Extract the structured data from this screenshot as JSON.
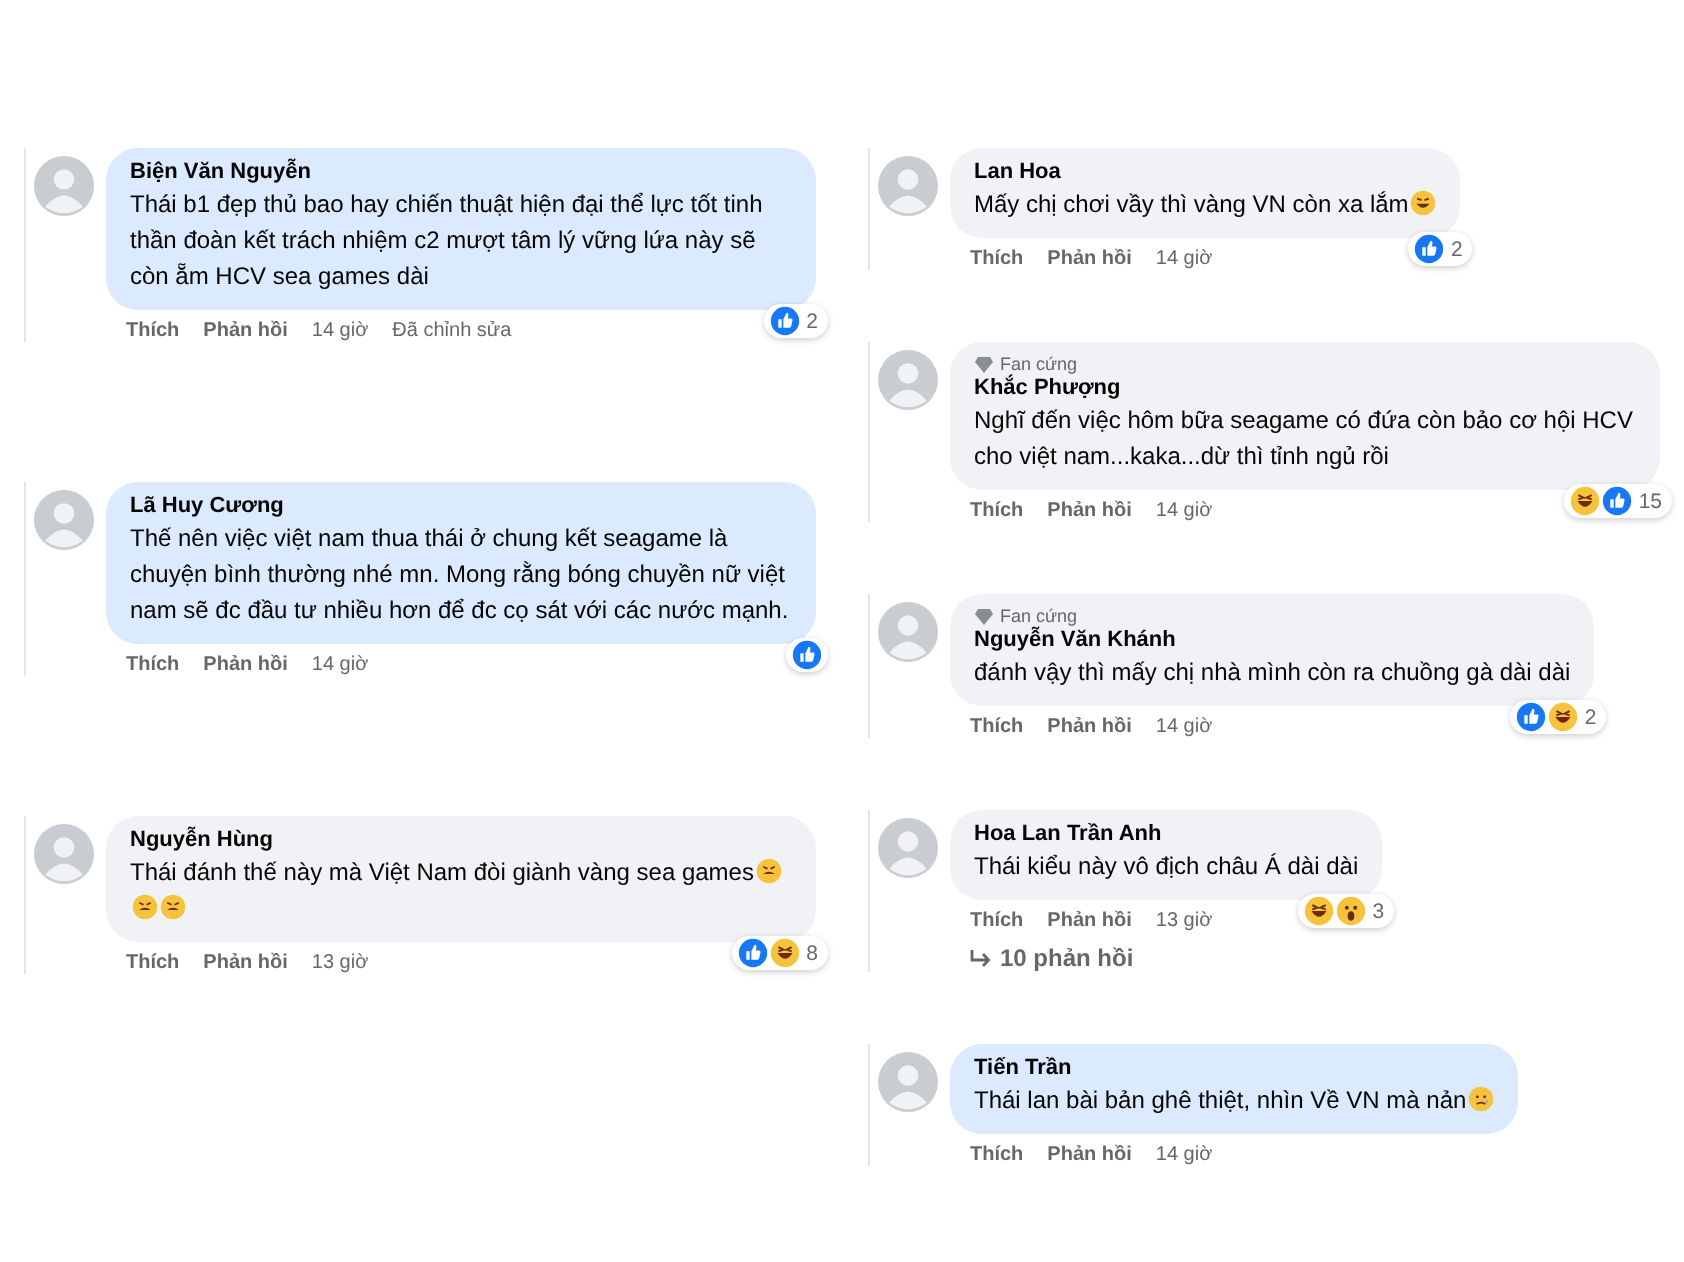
{
  "columns": [
    {
      "comments": [
        {
          "name": "Biện Văn Nguyễn",
          "text": "Thái b1 đẹp thủ bao hay chiến thuật hiện đại thể lực tốt tinh thần đoàn kết trách nhiệm c2 mượt tâm lý vững lứa này sẽ còn ẵm HCV sea games dài",
          "highlighted": true,
          "actions": [
            "Thích",
            "Phản hồi"
          ],
          "time": "14 giờ",
          "edited": "Đã chỉnh sửa",
          "reactions": [
            {
              "kind": "like"
            }
          ],
          "reaction_count": "2"
        },
        {
          "name": "Lã Huy Cương",
          "text": "Thế nên việc việt nam thua thái ở chung kết seagame là chuyện bình thường nhé mn. Mong rằng bóng chuyền nữ việt nam sẽ đc đầu tư nhiều hơn để đc cọ sát với các nước mạnh.",
          "highlighted": true,
          "actions": [
            "Thích",
            "Phản hồi"
          ],
          "time": "14 giờ",
          "reactions": [
            {
              "kind": "like"
            }
          ]
        },
        {
          "name": "Nguyễn Hùng",
          "text": "Thái đánh thế này mà Việt Nam đòi giành vàng sea games",
          "highlighted": false,
          "emojis": [
            {
              "kind": "tired"
            },
            {
              "kind": "tired"
            },
            {
              "kind": "tired"
            }
          ],
          "actions": [
            "Thích",
            "Phản hồi"
          ],
          "time": "13 giờ",
          "reactions": [
            {
              "kind": "like"
            },
            {
              "kind": "haha"
            }
          ],
          "reaction_count": "8"
        }
      ]
    },
    {
      "comments": [
        {
          "name": "Lan Hoa",
          "text": "Mấy chị chơi vầy thì vàng VN còn xa lắm",
          "highlighted": false,
          "emojis": [
            {
              "kind": "rofl"
            }
          ],
          "actions": [
            "Thích",
            "Phản hồi"
          ],
          "time": "14 giờ",
          "reactions": [
            {
              "kind": "like"
            }
          ],
          "reaction_count": "2"
        },
        {
          "badge": "Fan cứng",
          "name": "Khắc Phượng",
          "text": "Nghĩ đến việc hôm bữa seagame có đứa còn bảo cơ hội HCV cho việt nam...kaka...dừ thì tỉnh ngủ rồi",
          "highlighted": false,
          "actions": [
            "Thích",
            "Phản hồi"
          ],
          "time": "14 giờ",
          "reactions": [
            {
              "kind": "haha"
            },
            {
              "kind": "like"
            }
          ],
          "reaction_count": "15"
        },
        {
          "badge": "Fan cứng",
          "name": "Nguyễn Văn Khánh",
          "text": "đánh vậy thì mấy chị nhà mình còn ra chuồng gà dài dài",
          "highlighted": false,
          "actions": [
            "Thích",
            "Phản hồi"
          ],
          "time": "14 giờ",
          "reactions": [
            {
              "kind": "like"
            },
            {
              "kind": "haha"
            }
          ],
          "reaction_count": "2"
        },
        {
          "name": "Hoa Lan Trần Anh",
          "text": "Thái kiểu này vô địch châu Á dài dài",
          "highlighted": false,
          "actions": [
            "Thích",
            "Phản hồi"
          ],
          "time": "13 giờ",
          "reactions": [
            {
              "kind": "haha"
            },
            {
              "kind": "wow"
            }
          ],
          "reaction_count": "3",
          "replies": "10 phản hồi"
        },
        {
          "name": "Tiến Trần",
          "text": "Thái lan bài bản ghê thiệt, nhìn Về VN mà nản",
          "highlighted": true,
          "emojis": [
            {
              "kind": "sad"
            }
          ],
          "actions": [
            "Thích",
            "Phản hồi"
          ],
          "time": "14 giờ"
        }
      ]
    }
  ]
}
